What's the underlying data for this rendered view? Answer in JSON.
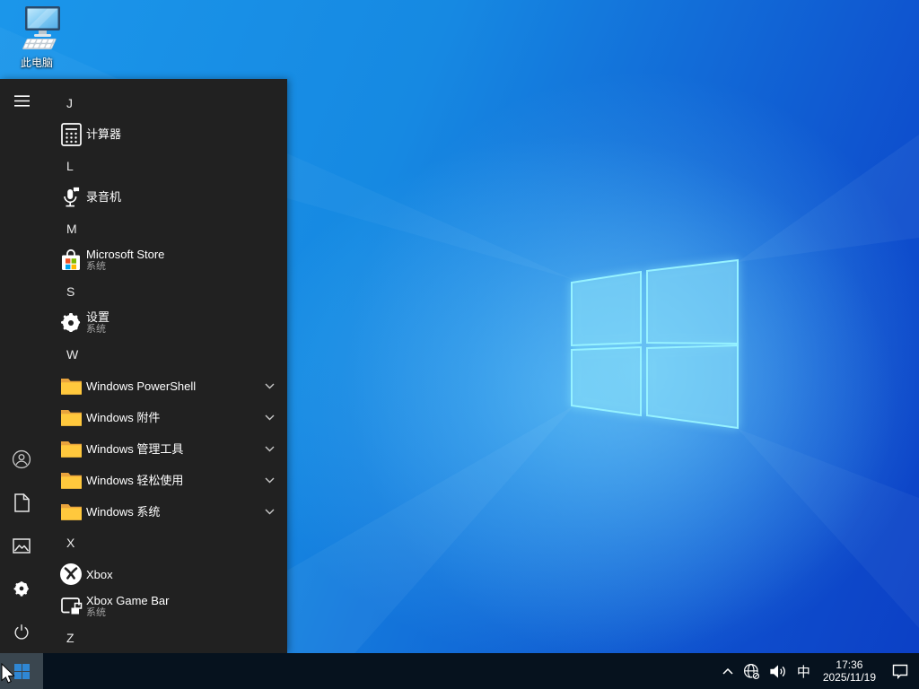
{
  "desktop": {
    "icons": [
      {
        "label": "此电脑",
        "icon": "this-pc-icon"
      }
    ]
  },
  "start_menu": {
    "rail": {
      "top": [
        {
          "name": "menu",
          "icon": "hamburger-icon"
        }
      ],
      "bottom": [
        {
          "name": "user",
          "icon": "user-icon"
        },
        {
          "name": "documents",
          "icon": "document-icon"
        },
        {
          "name": "pictures",
          "icon": "pictures-icon"
        },
        {
          "name": "settings",
          "icon": "gear-icon"
        },
        {
          "name": "power",
          "icon": "power-icon"
        }
      ]
    },
    "sections": [
      {
        "letter": "J",
        "items": [
          {
            "label": "计算器",
            "icon": "calculator-icon"
          }
        ]
      },
      {
        "letter": "L",
        "items": [
          {
            "label": "录音机",
            "icon": "voice-recorder-icon"
          }
        ]
      },
      {
        "letter": "M",
        "items": [
          {
            "label": "Microsoft Store",
            "sublabel": "系统",
            "icon": "store-icon"
          }
        ]
      },
      {
        "letter": "S",
        "items": [
          {
            "label": "设置",
            "sublabel": "系统",
            "icon": "settings-gear-icon"
          }
        ]
      },
      {
        "letter": "W",
        "items": [
          {
            "label": "Windows PowerShell",
            "icon": "folder-icon",
            "expandable": true
          },
          {
            "label": "Windows 附件",
            "icon": "folder-icon",
            "expandable": true
          },
          {
            "label": "Windows 管理工具",
            "icon": "folder-icon",
            "expandable": true
          },
          {
            "label": "Windows 轻松使用",
            "icon": "folder-icon",
            "expandable": true
          },
          {
            "label": "Windows 系统",
            "icon": "folder-icon",
            "expandable": true
          }
        ]
      },
      {
        "letter": "X",
        "items": [
          {
            "label": "Xbox",
            "icon": "xbox-icon"
          },
          {
            "label": "Xbox Game Bar",
            "sublabel": "系统",
            "icon": "gamebar-icon"
          }
        ]
      },
      {
        "letter": "Z",
        "items": []
      }
    ]
  },
  "taskbar": {
    "start": {
      "icon": "windows-logo-icon"
    },
    "tray": {
      "hidden_icons_icon": "chevron-up-icon",
      "network_icon": "globe-no-internet-icon",
      "volume_icon": "speaker-icon",
      "ime_label": "中",
      "clock_time": "17:36",
      "clock_date": "2025/11/19",
      "action_center_icon": "action-center-icon"
    }
  },
  "colors": {
    "taskbar_bg": "#06121e",
    "start_menu_bg": "#212121",
    "start_button_active_bg": "#3a464f",
    "windows_flag_blue": "#2f87d4",
    "subtitle_gray": "#a2a2a2",
    "folder_yellow": "#ffb900",
    "store_red": "#f25022",
    "store_green": "#7fba00",
    "store_blue": "#00a4ef",
    "store_yellow": "#ffb900",
    "wallpaper_bright": "#2aa3f2",
    "wallpaper_deep": "#0c3fc5"
  }
}
